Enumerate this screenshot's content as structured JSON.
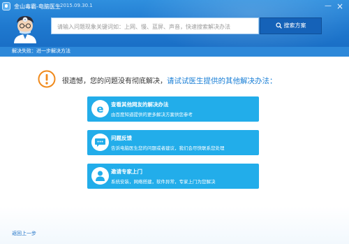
{
  "window": {
    "title": "金山毒霸-电脑医生",
    "version": "2015.09.30.1",
    "minimize_symbol": "—",
    "close_symbol": "×"
  },
  "search": {
    "placeholder": "请输入问题现象关键词如：上网、慢、蓝屏、声音，快速搜索解决办法",
    "button_label": "搜索方案"
  },
  "breadcrumb": "解决失败：进一步解决方法",
  "message": {
    "text": "很遗憾，您的问题没有彻底解决，",
    "highlight": "请试试医生提供的其他解决办法："
  },
  "options": [
    {
      "title": "查看其他网友的解决办法",
      "desc": "由百度知道提供的更多解决方案供您参考",
      "icon": "e-browser-icon"
    },
    {
      "title": "问题反馈",
      "desc": "告诉电脑医生您的问题或者建议，我们会尽快联系您处理",
      "icon": "chat-icon"
    },
    {
      "title": "邀请专家上门",
      "desc": "系统安装，网络搭建，软件异常，专家上门为您解决",
      "icon": "expert-icon"
    }
  ],
  "footer": {
    "back_label": "返回上一步"
  },
  "colors": {
    "header": "#1f79cf",
    "breadcrumb_bar": "#2d88d9",
    "option": "#22adea",
    "warning": "#f08a1c",
    "search_button": "#1562b8"
  }
}
